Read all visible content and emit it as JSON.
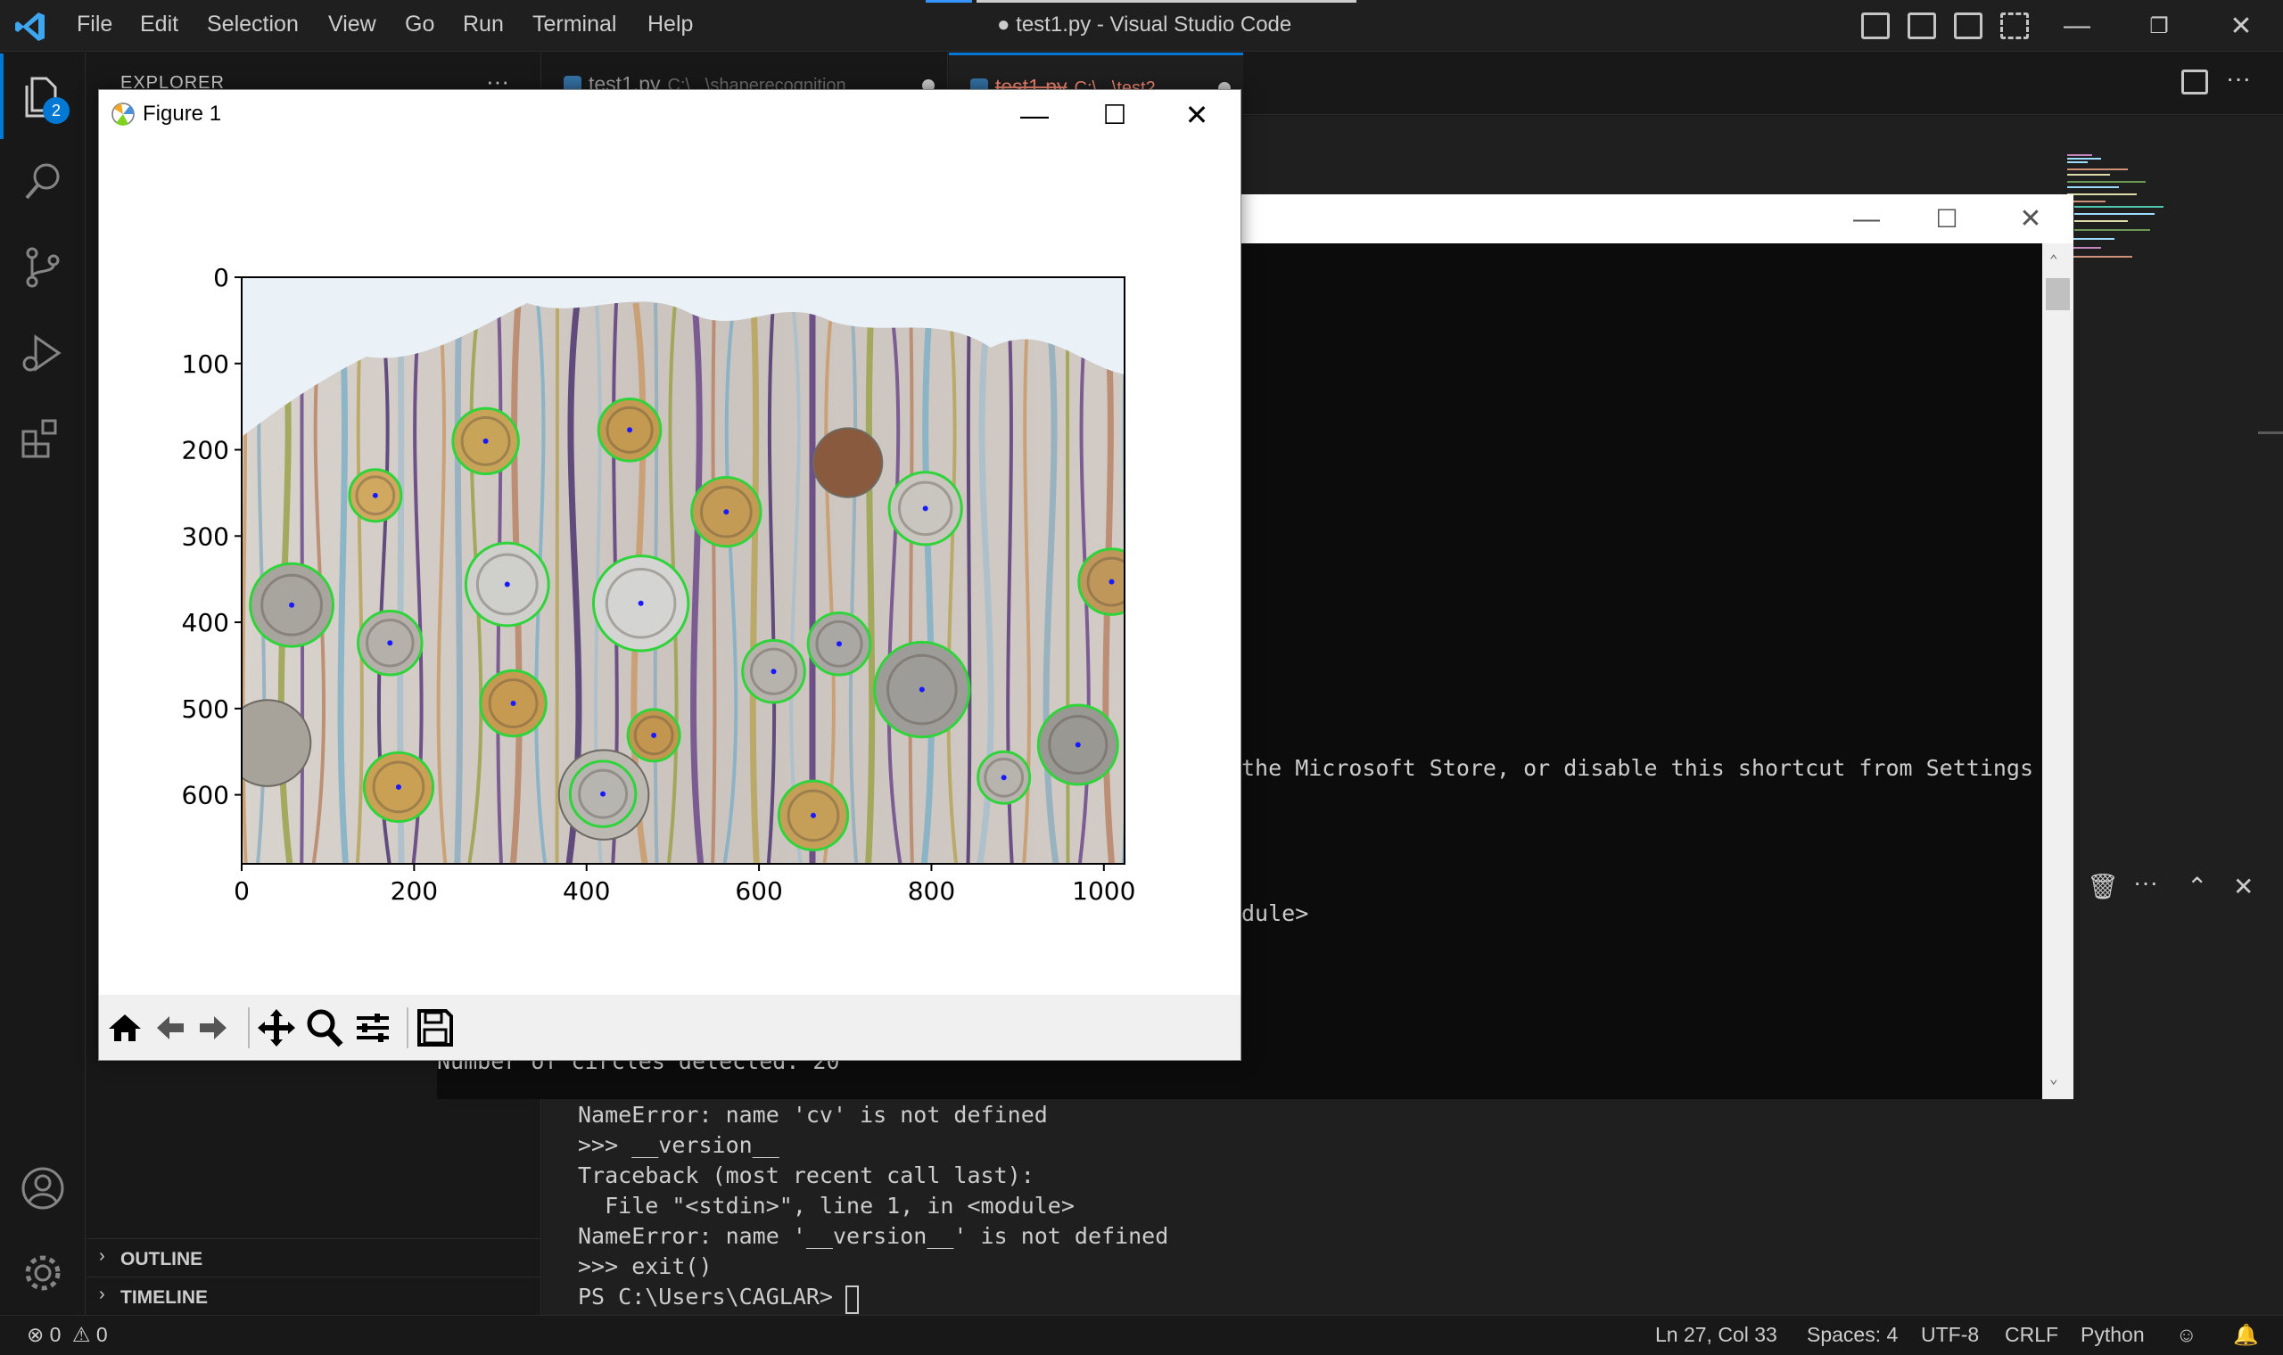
{
  "window": {
    "title": "● test1.py - Visual Studio Code",
    "menu": [
      "File",
      "Edit",
      "Selection",
      "View",
      "Go",
      "Run",
      "Terminal",
      "Help"
    ]
  },
  "activity_bar": {
    "explorer_badge": "2",
    "icons": [
      "files-icon",
      "search-icon",
      "source-control-icon",
      "run-debug-icon",
      "extensions-icon",
      "account-icon",
      "settings-gear-icon"
    ]
  },
  "sidebar": {
    "title": "EXPLORER",
    "more": "···",
    "sections": [
      {
        "label": "OUTLINE",
        "chevron": "›"
      },
      {
        "label": "TIMELINE",
        "chevron": "›"
      }
    ]
  },
  "tabs": [
    {
      "label": "test1.py",
      "path": "C:\\...\\shaperecognition"
    },
    {
      "label": "test1.py",
      "path": "C:\\...\\test2"
    }
  ],
  "figure": {
    "title": "Figure 1",
    "chart_data": {
      "type": "image",
      "xticks": [
        "0",
        "200",
        "400",
        "600",
        "800",
        "1000"
      ],
      "yticks": [
        "0",
        "100",
        "200",
        "300",
        "400",
        "500",
        "600"
      ],
      "xlim": [
        0,
        1024
      ],
      "ylim": [
        680,
        0
      ],
      "circles": [
        {
          "x": 283,
          "y": 190,
          "r": 38,
          "color": "#c8a458"
        },
        {
          "x": 450,
          "y": 177,
          "r": 36,
          "color": "#c39a4f"
        },
        {
          "x": 155,
          "y": 253,
          "r": 30,
          "color": "#d0a860"
        },
        {
          "x": 562,
          "y": 272,
          "r": 40,
          "color": "#c49b54"
        },
        {
          "x": 793,
          "y": 268,
          "r": 42,
          "color": "#c9c6bf"
        },
        {
          "x": 58,
          "y": 380,
          "r": 48,
          "color": "#a8a49e"
        },
        {
          "x": 308,
          "y": 356,
          "r": 48,
          "color": "#cfcfcc"
        },
        {
          "x": 463,
          "y": 378,
          "r": 55,
          "color": "#d4d4d2"
        },
        {
          "x": 172,
          "y": 424,
          "r": 37,
          "color": "#b5b1aa"
        },
        {
          "x": 1009,
          "y": 353,
          "r": 38,
          "color": "#c0975a"
        },
        {
          "x": 693,
          "y": 425,
          "r": 36,
          "color": "#aaa8a4"
        },
        {
          "x": 617,
          "y": 457,
          "r": 36,
          "color": "#b6b3ad"
        },
        {
          "x": 789,
          "y": 478,
          "r": 55,
          "color": "#9e9c98"
        },
        {
          "x": 315,
          "y": 494,
          "r": 38,
          "color": "#c79a52"
        },
        {
          "x": 478,
          "y": 531,
          "r": 30,
          "color": "#c39650"
        },
        {
          "x": 970,
          "y": 542,
          "r": 46,
          "color": "#9a9893"
        },
        {
          "x": 884,
          "y": 580,
          "r": 30,
          "color": "#b7b4ad"
        },
        {
          "x": 182,
          "y": 591,
          "r": 40,
          "color": "#c9a054"
        },
        {
          "x": 419,
          "y": 599,
          "r": 38,
          "color": "#b7b5b0"
        },
        {
          "x": 663,
          "y": 624,
          "r": 40,
          "color": "#c59e58"
        }
      ],
      "extra_coins": [
        {
          "x": 703,
          "y": 215,
          "r": 40,
          "color": "#8a5a3e"
        },
        {
          "x": 30,
          "y": 540,
          "r": 50,
          "color": "#a7a39a"
        },
        {
          "x": 420,
          "y": 600,
          "r": 52,
          "color": "#bcb9b3"
        }
      ]
    },
    "toolbar": [
      "home-icon",
      "back-icon",
      "forward-icon",
      "pan-icon",
      "zoom-icon",
      "configure-icon",
      "save-icon"
    ]
  },
  "console": {
    "lines": [
      {
        "top": 847,
        "text": "the Microsoft Store, or disable this shortcut from Settings"
      },
      {
        "top": 1010,
        "text": "dule>"
      },
      {
        "top": 1176,
        "text": "Number of circles detected: 20"
      }
    ]
  },
  "terminal": {
    "lines": [
      "NameError: name 'cv' is not defined",
      ">>> __version__",
      "Traceback (most recent call last):",
      "  File \"<stdin>\", line 1, in <module>",
      "NameError: name '__version__' is not defined",
      ">>> exit()",
      "PS C:\\Users\\CAGLAR> "
    ]
  },
  "statusbar": {
    "errors": "0",
    "warnings": "0",
    "position": "Ln 27, Col 33",
    "spaces": "Spaces: 4",
    "encoding": "UTF-8",
    "eol": "CRLF",
    "language": "Python"
  }
}
